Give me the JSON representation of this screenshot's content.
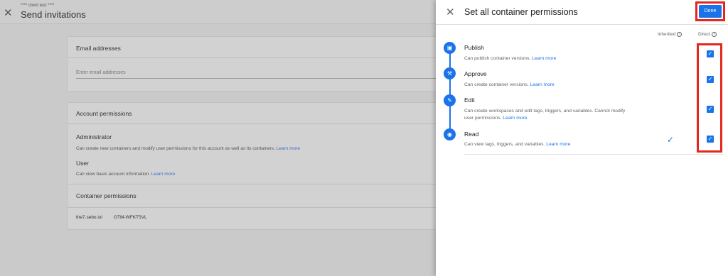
{
  "background": {
    "app_subtitle": "**** client test ****",
    "page_title": "Send invitations",
    "email_card": {
      "title": "Email addresses",
      "placeholder": "Enter email addresses"
    },
    "account_card": {
      "title": "Account permissions",
      "admin_title": "Administrator",
      "admin_desc": "Can create new containers and modify user permissions for this account as well as its containers.",
      "user_title": "User",
      "user_desc": "Can view basic account information.",
      "learn_more": "Learn more",
      "container_section_title": "Container permissions",
      "container_domain": "the7.sebo.io/",
      "container_id": "GTM-WFKT5VL"
    }
  },
  "panel": {
    "title": "Set all container permissions",
    "done_label": "Done",
    "col_inherited": "Inherited",
    "col_direct": "Direct",
    "learn_more": "Learn more",
    "permissions": [
      {
        "name": "Publish",
        "desc": "Can publish container versions.",
        "icon": "publish-icon",
        "direct_checked": true
      },
      {
        "name": "Approve",
        "desc": "Can create container versions.",
        "icon": "approve-icon",
        "direct_checked": true
      },
      {
        "name": "Edit",
        "desc_line1": "Can create workspaces and edit tags, triggers, and variables. Cannot modify",
        "desc_line2": "user permissions.",
        "icon": "edit-icon",
        "direct_checked": true
      },
      {
        "name": "Read",
        "desc": "Can view tags, triggers, and variables.",
        "icon": "read-icon",
        "direct_checked": true,
        "inherited": true
      }
    ],
    "colors": {
      "accent": "#1a73e8",
      "highlight": "#e3271d"
    }
  }
}
